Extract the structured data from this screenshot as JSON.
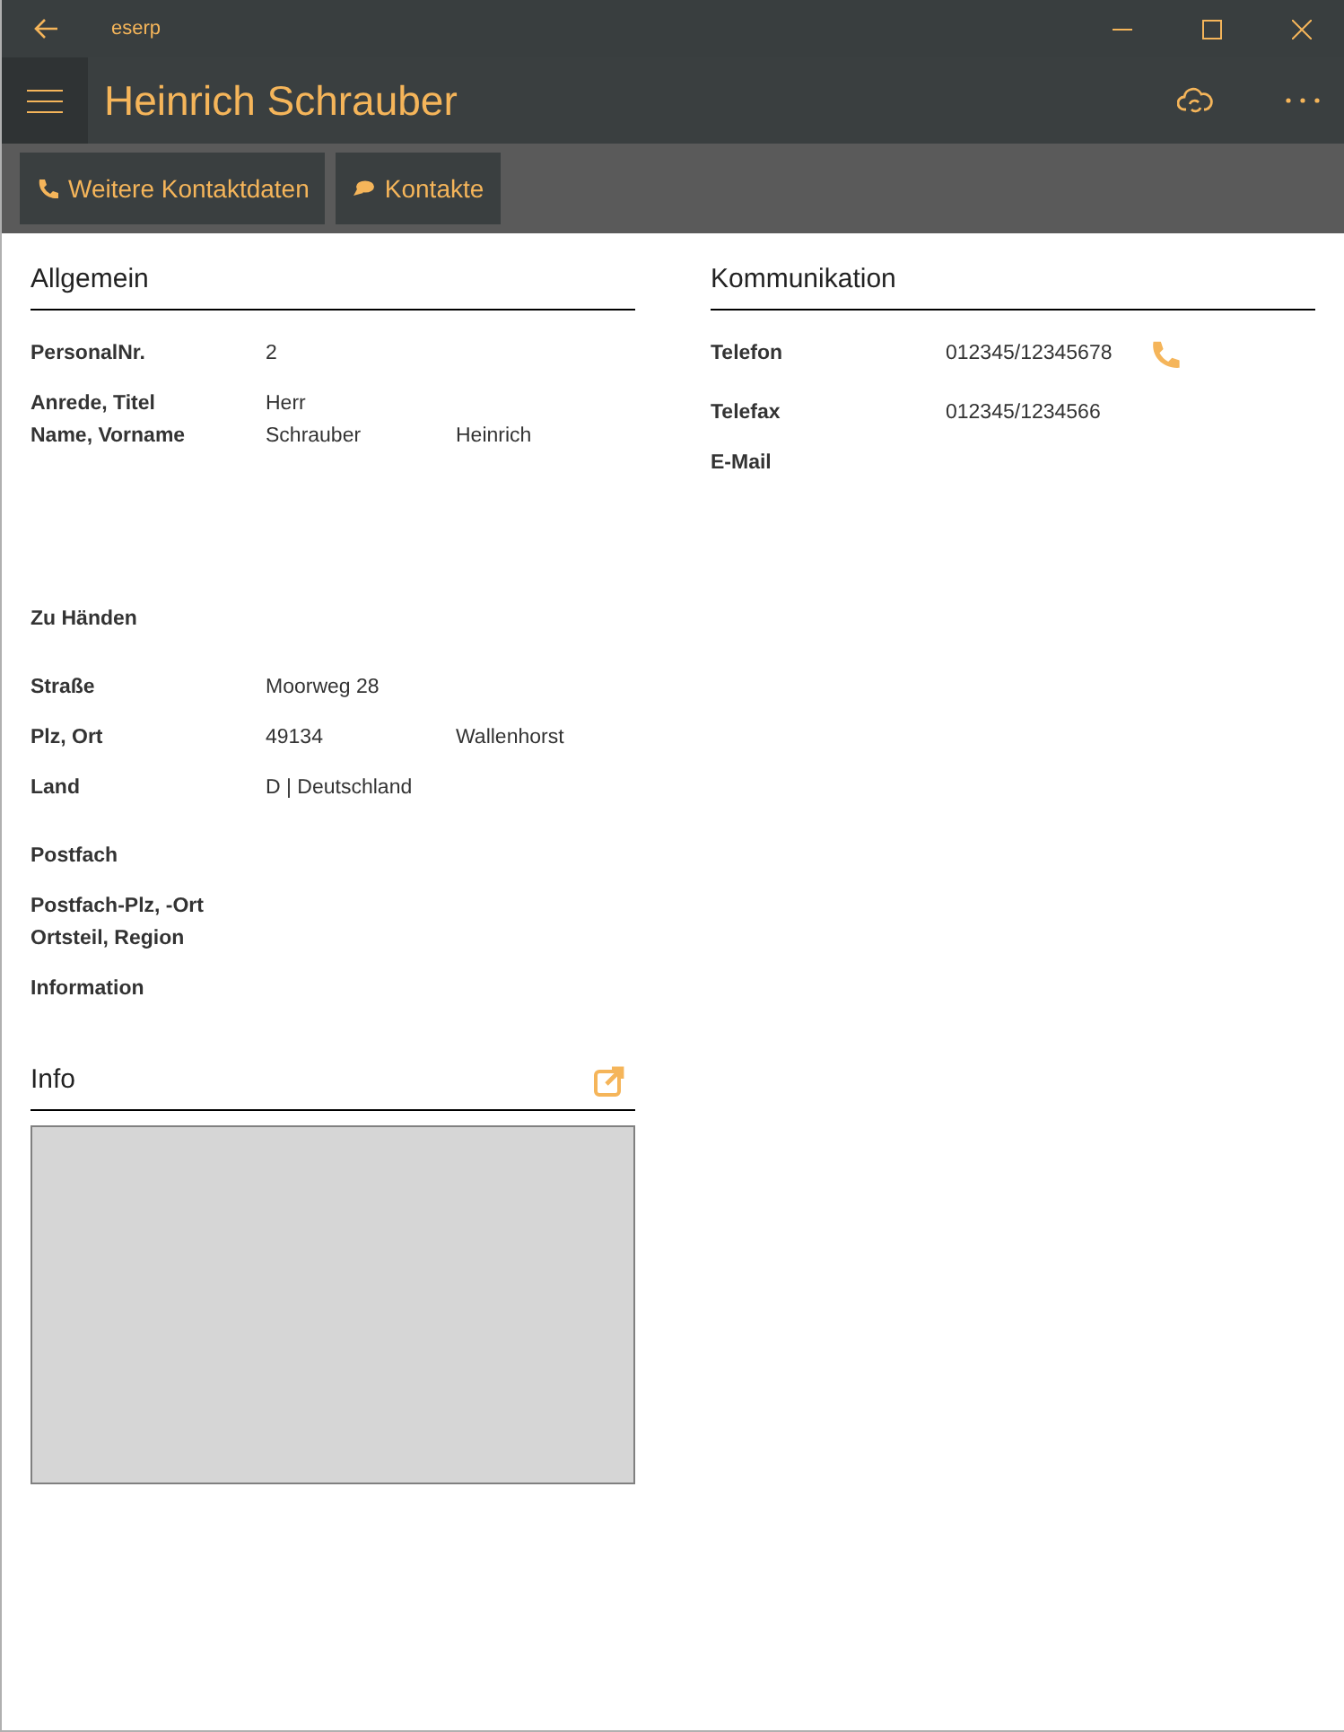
{
  "window": {
    "title": "eserp"
  },
  "header": {
    "title": "Heinrich Schrauber"
  },
  "toolbar": {
    "buttons": [
      {
        "label": "Weitere Kontaktdaten",
        "kind": "phone"
      },
      {
        "label": "Kontakte",
        "kind": "chat"
      }
    ]
  },
  "allgemein": {
    "title": "Allgemein",
    "groups": [
      [
        {
          "label": "PersonalNr.",
          "values": [
            "2"
          ]
        }
      ],
      [
        {
          "label": "Anrede, Titel",
          "values": [
            "Herr"
          ]
        },
        {
          "label": "Name, Vorname",
          "values": [
            "Schrauber",
            "Heinrich"
          ]
        }
      ],
      [
        {
          "label": "Zu Händen"
        }
      ],
      [
        {
          "label": "Straße",
          "values": [
            "Moorweg 28"
          ]
        }
      ],
      [
        {
          "label": "Plz, Ort",
          "values": [
            "49134",
            "Wallenhorst"
          ]
        }
      ],
      [
        {
          "label": "Land",
          "values": [
            "D | Deutschland"
          ]
        }
      ],
      [
        {
          "label": "Postfach"
        }
      ],
      [
        {
          "label": "Postfach-Plz, -Ort"
        },
        {
          "label": "Ortsteil, Region"
        }
      ],
      [
        {
          "label": "Information"
        }
      ]
    ]
  },
  "kommunikation": {
    "title": "Kommunikation",
    "groups": [
      [
        {
          "label": "Telefon",
          "values": [
            "012345/12345678"
          ],
          "call": true
        }
      ],
      [
        {
          "label": "Telefax",
          "values": [
            "012345/1234566"
          ]
        }
      ],
      [
        {
          "label": "E-Mail"
        }
      ]
    ]
  },
  "info": {
    "title": "Info"
  }
}
